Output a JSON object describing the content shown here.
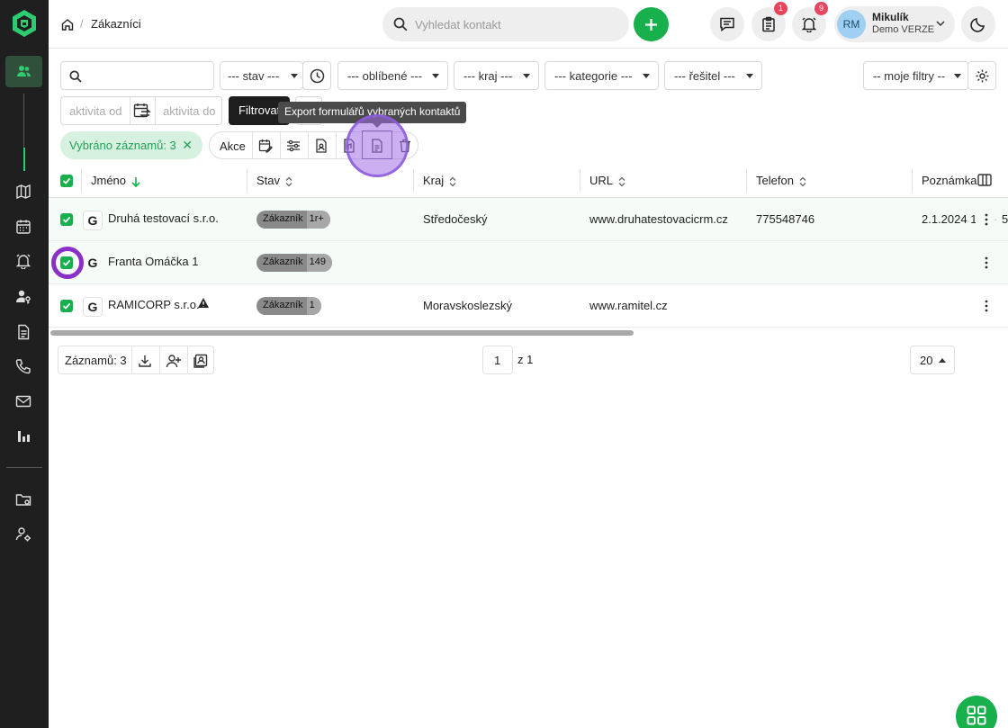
{
  "breadcrumb": {
    "current": "Zákazníci"
  },
  "search": {
    "placeholder": "Vyhledat kontakt"
  },
  "header": {
    "tasks_badge": "1",
    "notifications_badge": "9",
    "user_initials": "RM",
    "user_name": "Mikulík",
    "user_sub": "Demo VERZE"
  },
  "filters": {
    "stav": "--- stav ---",
    "oblibene": "--- oblíbené ---",
    "kraj": "--- kraj ---",
    "kategorie": "--- kategorie ---",
    "resitel": "--- řešitel ---",
    "moje_filtry": "-- moje filtry --",
    "aktivita_od_placeholder": "aktivita od",
    "aktivita_do_placeholder": "aktivita do",
    "filter_button": "Filtrovat"
  },
  "tooltip": {
    "export_forms": "Export formulářů vybraných kontaktů"
  },
  "selection": {
    "label": "Vybráno záznamů: 3",
    "actions_label": "Akce"
  },
  "table": {
    "columns": [
      "Jméno",
      "Stav",
      "Kraj",
      "URL",
      "Telefon",
      "Poznámka"
    ],
    "rows": [
      {
        "name": "Druhá testovací s.r.o.",
        "status": "Zákazník",
        "status_count": "1r+",
        "region": "Středočeský",
        "url": "www.druhatestovacicrm.cz",
        "phone": "775548746",
        "note": "2.1.2024 1",
        "extra": "5",
        "checked": true,
        "warning": false
      },
      {
        "name": "Franta Omáčka 1",
        "status": "Zákazník",
        "status_count": "149",
        "region": "",
        "url": "",
        "phone": "",
        "note": "",
        "extra": "",
        "checked": true,
        "warning": false
      },
      {
        "name": "RAMICORP s.r.o.",
        "status": "Zákazník",
        "status_count": "1",
        "region": "Moravskoslezský",
        "url": "www.ramitel.cz",
        "phone": "",
        "note": "",
        "extra": "",
        "checked": true,
        "warning": true
      }
    ]
  },
  "footer": {
    "records": "Záznamů: 3",
    "page": "1",
    "page_of": "z 1",
    "page_size": "20"
  },
  "colors": {
    "primary_green": "#17b04c",
    "sidebar": "#1f1f1f",
    "badge_red": "#e8455c",
    "highlight_purple": "#8a2fc8"
  },
  "icons": [
    "contacts-icon",
    "map-icon",
    "calendar-icon",
    "bell-icon",
    "user-key-icon",
    "document-icon",
    "phone-icon",
    "mail-icon",
    "bar-chart-icon",
    "folder-settings-icon",
    "user-settings-icon"
  ]
}
